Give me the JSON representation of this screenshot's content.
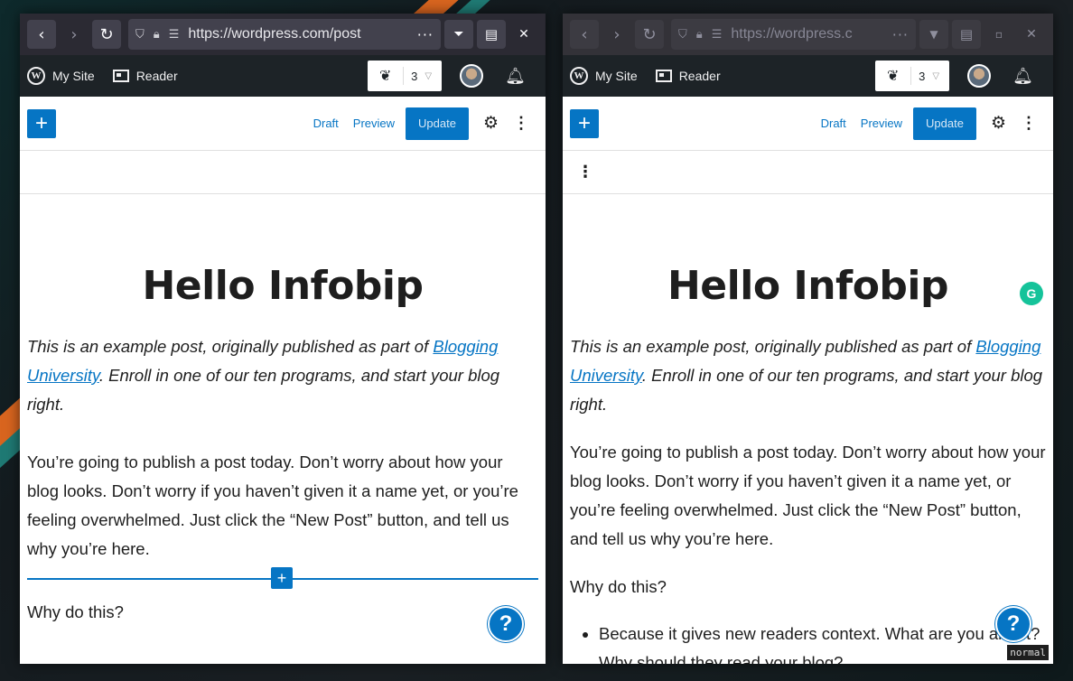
{
  "colors": {
    "accent": "#0675c4",
    "admin_bar": "#1d2327",
    "browser_toolbar": "#2b2a33",
    "grammarly": "#15c39a"
  },
  "icons": {
    "back": "chevron-left-icon",
    "forward": "chevron-right-icon",
    "reload": "reload-icon",
    "shield": "shield-icon",
    "lock": "lock-icon",
    "permissions": "permissions-icon",
    "more": "ellipsis-icon",
    "downloads": "downloads-icon",
    "reader_view": "reader-view-icon",
    "close": "close-icon",
    "maximize": "maximize-icon",
    "wordpress": "wordpress-logo-icon",
    "reader": "reader-icon",
    "leaf": "leaf-icon",
    "bell": "bell-icon",
    "gear": "gear-icon",
    "kebab": "kebab-menu-icon",
    "help": "help-icon",
    "grammarly": "grammarly-icon"
  },
  "left_window": {
    "url": "https://wordpress.com/post",
    "more": "···",
    "close": "✕"
  },
  "right_window": {
    "url": "https://wordpress.c",
    "more": "···",
    "close": "✕"
  },
  "admin_bar": {
    "my_site": "My Site",
    "reader": "Reader",
    "count": "3"
  },
  "editor": {
    "draft": "Draft",
    "preview": "Preview",
    "update": "Update"
  },
  "post": {
    "title": "Hello Infobip",
    "intro_before": "This is an example post, originally published as part of ",
    "intro_link": "Blogging University",
    "intro_after": ". Enroll in one of our ten programs, and start your blog right.",
    "para": "You’re going to publish a post today. Don’t worry about how your blog looks. Don’t worry if you haven’t given it a name yet, or you’re feeling overwhelmed. Just click the “New Post” button, and tell us why you’re here.",
    "heading": "Why do this?",
    "bullet_1": "Because it gives new readers context. What are you about? Why should they read your blog?"
  },
  "help_label": "?",
  "grammarly_label": "G",
  "mode_badge": "normal"
}
